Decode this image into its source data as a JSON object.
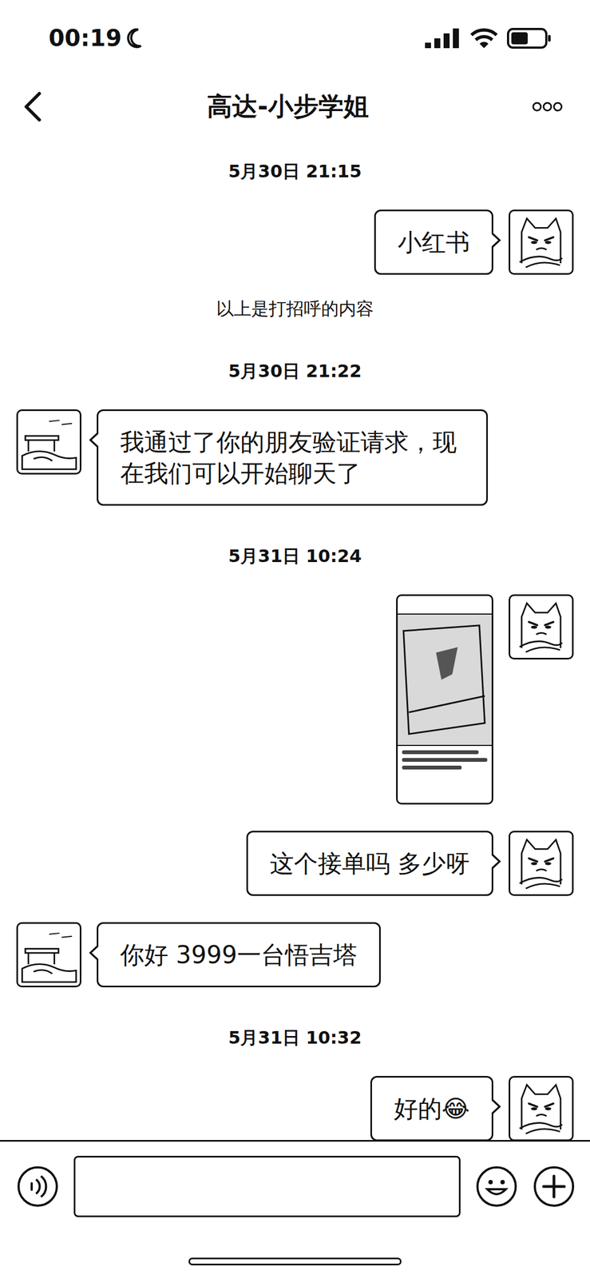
{
  "status_bar": {
    "time": "00:19"
  },
  "header": {
    "title": "高达-小步学姐"
  },
  "messages": [
    {
      "kind": "time",
      "text": "5月30日 21:15"
    },
    {
      "kind": "text",
      "from": "me",
      "text": "小红书"
    },
    {
      "kind": "system",
      "text": "以上是打招呼的内容"
    },
    {
      "kind": "time",
      "text": "5月30日 21:22"
    },
    {
      "kind": "text",
      "from": "them",
      "text": "我通过了你的朋友验证请求，现在我们可以开始聊天了"
    },
    {
      "kind": "time",
      "text": "5月31日 10:24"
    },
    {
      "kind": "image",
      "from": "me"
    },
    {
      "kind": "text",
      "from": "me",
      "text": "这个接单吗 多少呀"
    },
    {
      "kind": "text",
      "from": "them",
      "text": "你好 3999一台悟吉塔"
    },
    {
      "kind": "time",
      "text": "5月31日 10:32"
    },
    {
      "kind": "text",
      "from": "me",
      "text": "好的😂"
    }
  ]
}
